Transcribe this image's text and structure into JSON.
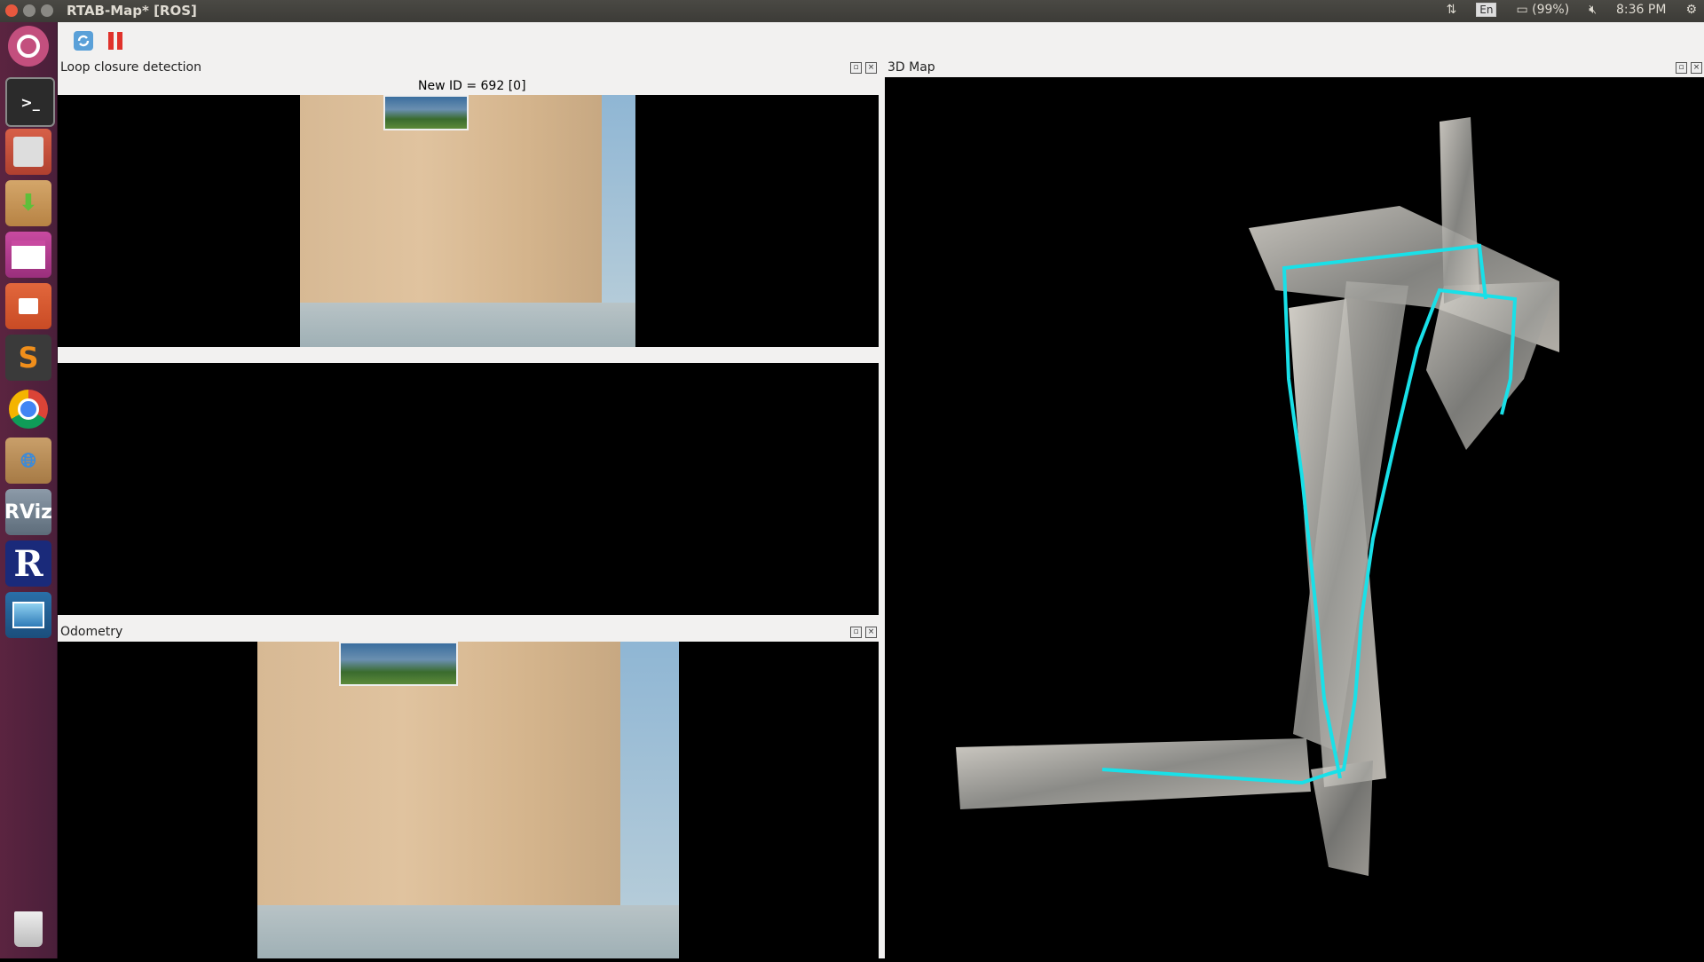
{
  "window": {
    "title": "RTAB-Map* [ROS]"
  },
  "topbar": {
    "keyboard": "En",
    "battery": "(99%)",
    "time": "8:36 PM"
  },
  "launcher": {
    "items": [
      "ubuntu-dash",
      "terminal",
      "file-cabinet",
      "software-install",
      "window-app",
      "files",
      "sublime-text",
      "chrome",
      "web-archive",
      "rviz",
      "rtabmap",
      "image-viewer",
      "trash"
    ],
    "rviz_label": "RViz",
    "rtabmap_label": "R"
  },
  "toolbar": {
    "refresh": "refresh-icon",
    "pause": "pause-icon"
  },
  "panels": {
    "loop_closure": {
      "title": "Loop closure detection",
      "status": "New ID = 692 [0]"
    },
    "map3d": {
      "title": "3D Map"
    },
    "odometry": {
      "title": "Odometry"
    }
  },
  "colors": {
    "trajectory": "#19e0e8",
    "panel_bg": "#f2f1f0",
    "launcher_bg": "#5b2440"
  }
}
